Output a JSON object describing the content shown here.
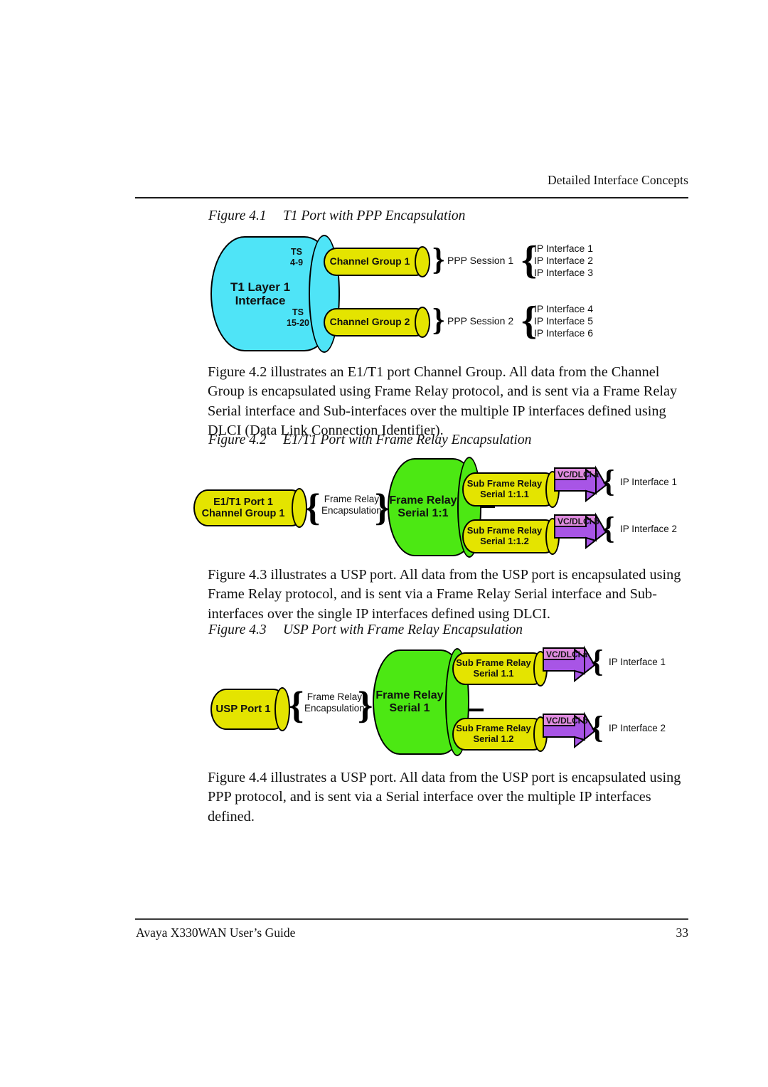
{
  "page": {
    "running_head": "Detailed Interface Concepts",
    "footer_title": "Avaya X330WAN User’s Guide",
    "page_number": "33"
  },
  "colors": {
    "cyan": "#4FE4F7",
    "yellow": "#E4E400",
    "green": "#4CE813",
    "magenta": "#E08CE0",
    "purple": "#A855E6",
    "outline": "#000000"
  },
  "figures": [
    {
      "caption_number": "Figure 4.1",
      "caption_title": "T1 Port with PPP Encapsulation",
      "t1_cylinder": {
        "line1": "T1 Layer 1",
        "line2": "Interface"
      },
      "ts_labels": [
        {
          "line1": "TS",
          "line2": "4-9"
        },
        {
          "line1": "TS",
          "line2": "15-20"
        }
      ],
      "channel_groups": [
        "Channel Group 1",
        "Channel Group 2"
      ],
      "sessions": [
        "PPP Session 1",
        "PPP Session 2"
      ],
      "interface_groups": [
        [
          "IP Interface 1",
          "IP Interface 2",
          "IP Interface 3"
        ],
        [
          "IP Interface 4",
          "IP Interface 5",
          "IP Interface 6"
        ]
      ]
    },
    {
      "caption_number": "Figure 4.2",
      "caption_title": "E1/T1 Port with Frame Relay Encapsulation",
      "source": {
        "line1": "E1/T1 Port 1",
        "line2": "Channel Group 1"
      },
      "encapsulation": {
        "line1": "Frame Relay",
        "line2": "Encapsulation"
      },
      "serial": {
        "line1": "Frame Relay",
        "line2": "Serial 1:1"
      },
      "subinterfaces": [
        {
          "line1": "Sub Frame Relay",
          "line2": "Serial 1:1.1",
          "dlci": "VC/DLCI a",
          "ip": "IP Interface 1"
        },
        {
          "line1": "Sub Frame Relay",
          "line2": "Serial 1:1.2",
          "dlci": "VC/DLCI b",
          "ip": "IP Interface 2"
        }
      ]
    },
    {
      "caption_number": "Figure 4.3",
      "caption_title": "USP Port with Frame Relay Encapsulation",
      "source": {
        "line1": "USP Port 1",
        "line2": ""
      },
      "encapsulation": {
        "line1": "Frame Relay",
        "line2": "Encapsulation"
      },
      "serial": {
        "line1": "Frame Relay",
        "line2": "Serial 1"
      },
      "subinterfaces": [
        {
          "line1": "Sub Frame Relay",
          "line2": "Serial 1.1",
          "dlci": "VC/DLCI a",
          "ip": "IP Interface 1"
        },
        {
          "line1": "Sub Frame Relay",
          "line2": "Serial 1.2",
          "dlci": "VC/DLCI b",
          "ip": "IP Interface 2"
        }
      ]
    }
  ],
  "paragraphs": {
    "p1": "Figure 4.2 illustrates an E1/T1 port Channel Group. All data from the Channel Group is encapsulated using Frame Relay protocol, and is sent via a Frame Relay Serial interface and Sub-interfaces over the multiple IP interfaces defined using DLCI (Data Link Connection Identifier).",
    "p2": "Figure 4.3 illustrates a USP port. All data from the USP port is encapsulated using Frame Relay protocol, and is sent via a Frame Relay Serial interface and Sub-interfaces over the single IP interfaces defined using DLCI.",
    "p3": "Figure 4.4 illustrates a USP port. All data from the USP port is encapsulated using PPP protocol, and is sent via a Serial interface over the multiple IP interfaces defined."
  }
}
